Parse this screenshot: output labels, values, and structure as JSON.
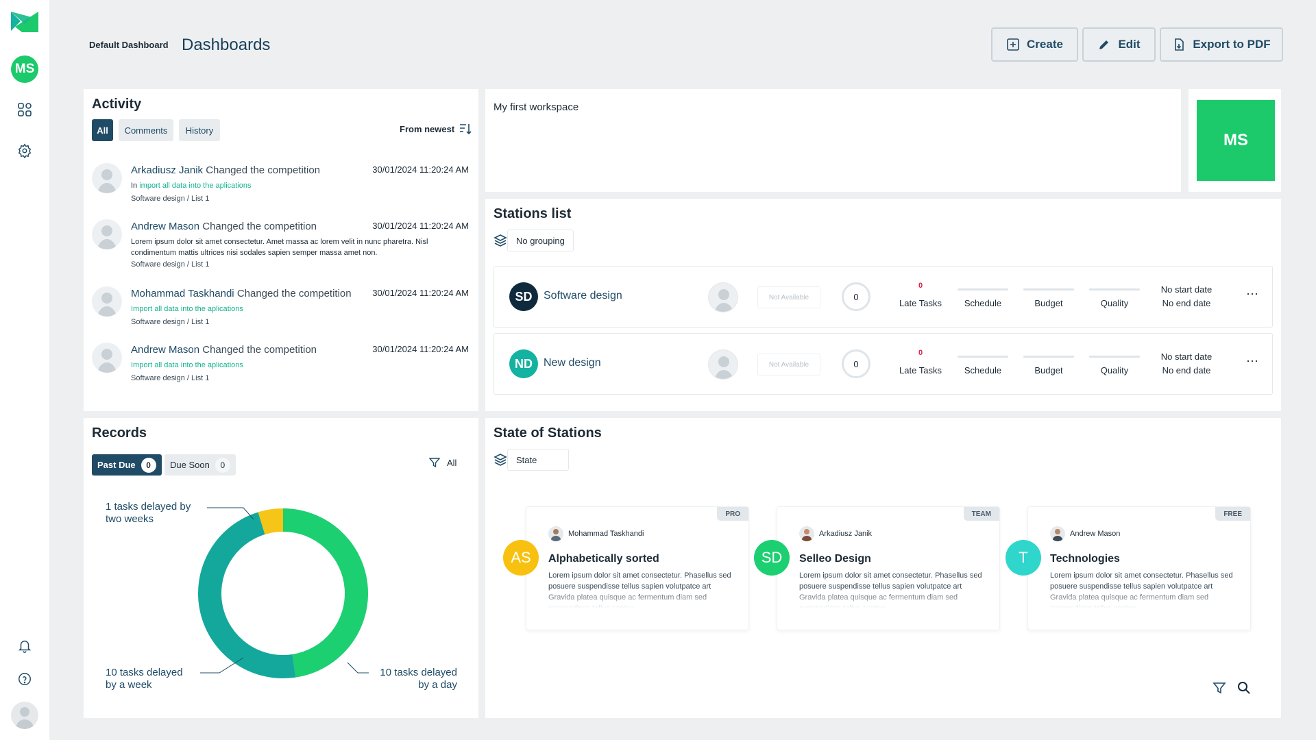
{
  "sidebar": {
    "avatar_initials": "MS",
    "icons": [
      "app-logo-icon",
      "dashboard-grid-icon",
      "settings-gear-icon",
      "bell-icon",
      "help-icon",
      "user-avatar-icon"
    ]
  },
  "header": {
    "breadcrumb": "Default Dashboard",
    "title": "Dashboards",
    "buttons": {
      "create": "Create",
      "edit": "Edit",
      "export": "Export to PDF"
    }
  },
  "activity": {
    "title": "Activity",
    "tabs": {
      "all": "All",
      "comments": "Comments",
      "history": "History"
    },
    "sort_label": "From newest",
    "items": [
      {
        "name": "Arkadiusz Janik",
        "action": "Changed the competition",
        "time": "30/01/2024 11:20:24 AM",
        "prefix": "In ",
        "link": "import all data into the aplications",
        "body": "",
        "path": "Software design / List 1"
      },
      {
        "name": "Andrew Mason",
        "action": "Changed the competition",
        "time": "30/01/2024 11:20:24 AM",
        "prefix": "",
        "link": "",
        "body1": "Lorem ipsum dolor sit amet consectetur. Amet massa ac lorem velit in nunc pharetra. Nisl",
        "body2": "condimentum mattis ultrices nisi sodales sapien semper massa amet non.",
        "path": "Software design / List 1"
      },
      {
        "name": "Mohammad Taskhandi",
        "action": "Changed the competition",
        "time": "30/01/2024 11:20:24 AM",
        "prefix": "",
        "link": "Import all data into the aplications",
        "path": "Software design / List 1"
      },
      {
        "name": "Andrew Mason",
        "action": "Changed the competition",
        "time": "30/01/2024 11:20:24 AM",
        "prefix": "",
        "link": "Import all data into the aplications",
        "path": "Software design / List 1"
      }
    ]
  },
  "workspace": {
    "label": "My first workspace",
    "badge": "MS"
  },
  "stations_list": {
    "title": "Stations list",
    "grouping": "No grouping",
    "rows": [
      {
        "initials": "SD",
        "name": "Software design",
        "avatar_color": "#0f2a3d",
        "not_available": "Not Available",
        "count": "0",
        "late_count": "0",
        "late_label": "Late Tasks",
        "schedule": "Schedule",
        "budget": "Budget",
        "quality": "Quality",
        "start": "No start date",
        "end": "No end date"
      },
      {
        "initials": "ND",
        "name": "New design",
        "avatar_color": "#14b2a0",
        "not_available": "Not Available",
        "count": "0",
        "late_count": "0",
        "late_label": "Late Tasks",
        "schedule": "Schedule",
        "budget": "Budget",
        "quality": "Quality",
        "start": "No start date",
        "end": "No end date"
      }
    ]
  },
  "records": {
    "title": "Records",
    "tabs": {
      "past_due": "Past Due",
      "past_due_count": "0",
      "due_soon": "Due Soon",
      "due_soon_count": "0"
    },
    "filter": "All",
    "donut": {
      "segments": [
        {
          "label1": "1 tasks delayed by",
          "label2": "two weeks",
          "value": 1,
          "color": "#f5c518"
        },
        {
          "label1": "10 tasks delayed",
          "label2": "by a day",
          "value": 10,
          "color": "#1ccf70"
        },
        {
          "label1": "10 tasks delayed",
          "label2": "by a week",
          "value": 10,
          "color": "#14a89c"
        }
      ]
    }
  },
  "state_of_stations": {
    "title": "State of Stations",
    "filter": "State",
    "cards": [
      {
        "tag": "PRO",
        "owner": "Mohammad Taskhandi",
        "initials": "AS",
        "avatar_color": "#f9c10f",
        "title": "Alphabetically sorted",
        "desc": "Lorem ipsum dolor sit amet consectetur. Phasellus sed posuere suspendisse tellus sapien volutpatce art Gravida platea quisque ac fermentum diam sed suspendisse tellus sapien."
      },
      {
        "tag": "TEAM",
        "owner": "Arkadiusz Janik",
        "initials": "SD",
        "avatar_color": "#1ccf70",
        "title": "Selleo Design",
        "desc": "Lorem ipsum dolor sit amet consectetur. Phasellus sed posuere suspendisse tellus sapien volutpatce art Gravida platea quisque ac fermentum diam sed suspendisse tellus sapien."
      },
      {
        "tag": "FREE",
        "owner": "Andrew Mason",
        "initials": "T",
        "avatar_color": "#2fd6cc",
        "title": "Technologies",
        "desc": "Lorem ipsum dolor sit amet consectetur. Phasellus sed posuere suspendisse tellus sapien volutpatce art Gravida platea quisque ac fermentum diam sed suspendisse tellus sapien."
      }
    ]
  },
  "colors": {
    "accent": "#1f4b66",
    "brand_green": "#1cc96b",
    "late_red": "#d9254a"
  }
}
